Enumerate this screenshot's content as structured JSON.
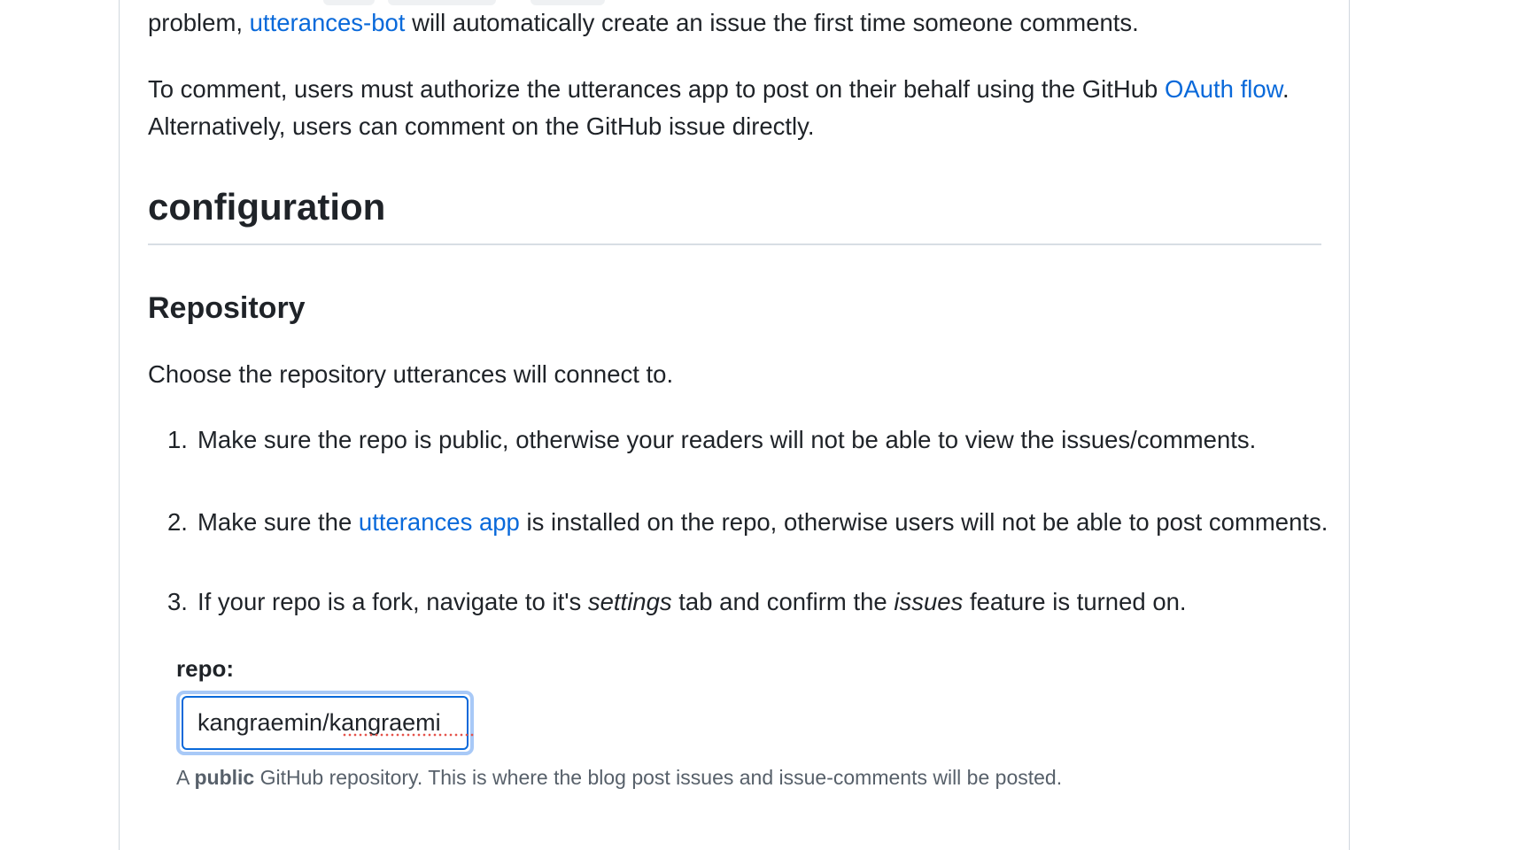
{
  "intro": {
    "p1_prefix": "problem,",
    "p1_link": "utterances-bot",
    "p1_suffix": "will automatically create an issue the first time someone comments.",
    "p2_text": "To comment, users must authorize the utterances app to post on their behalf using the GitHub",
    "p2_link": "OAuth flow",
    "p2_suffix": ". Alternatively, users can comment on the GitHub issue directly."
  },
  "configuration": {
    "heading": "configuration",
    "repository": {
      "heading": "Repository",
      "description": "Choose the repository utterances will connect to.",
      "steps": [
        {
          "number": "1.",
          "text": "Make sure the repo is public, otherwise your readers will not be able to view the issues/comments."
        },
        {
          "number": "2.",
          "prefix": "Make sure the",
          "link": "utterances app",
          "suffix": "is installed on the repo, otherwise users will not be able to post comments."
        },
        {
          "number": "3.",
          "prefix": "If your repo is a fork, navigate to it's",
          "em1": "settings",
          "middle": "tab and confirm the",
          "em2": "issues",
          "suffix": "feature is turned on."
        }
      ],
      "field": {
        "label": "repo:",
        "value": "kangraemin/kangraemi",
        "hint_prefix": "A",
        "hint_strong": "public",
        "hint_suffix": "GitHub repository. This is where the blog post issues and issue-comments will be posted."
      }
    }
  },
  "colors": {
    "link": "#0969da",
    "text": "#1f2328",
    "muted": "#57606a",
    "border": "#d0d7de",
    "focus": "#0969da"
  }
}
